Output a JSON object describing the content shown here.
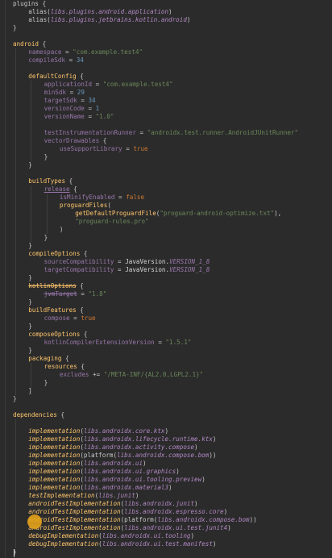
{
  "editor": {
    "lines": [
      {
        "indent": 0,
        "tokens": [
          [
            "plugins {",
            "t-plain"
          ]
        ]
      },
      {
        "indent": 1,
        "tokens": [
          [
            "alias(",
            "t-plain"
          ],
          [
            "libs.plugins.android.application",
            "t-lib"
          ],
          [
            ")",
            "t-plain"
          ]
        ]
      },
      {
        "indent": 1,
        "tokens": [
          [
            "alias(",
            "t-plain"
          ],
          [
            "libs.plugins.jetbrains.kotlin.android",
            "t-lib"
          ],
          [
            ")",
            "t-plain"
          ]
        ]
      },
      {
        "indent": 0,
        "tokens": [
          [
            "}",
            "t-plain"
          ]
        ]
      },
      {
        "indent": 0,
        "tokens": []
      },
      {
        "indent": 0,
        "tokens": [
          [
            "android",
            "t-fn"
          ],
          [
            " {",
            "t-plain"
          ]
        ]
      },
      {
        "indent": 1,
        "tokens": [
          [
            "namespace",
            "t-prop"
          ],
          [
            " = ",
            "t-plain"
          ],
          [
            "\"com.example.test4\"",
            "t-str"
          ]
        ]
      },
      {
        "indent": 1,
        "tokens": [
          [
            "compileSdk",
            "t-prop"
          ],
          [
            " = ",
            "t-plain"
          ],
          [
            "34",
            "t-num"
          ]
        ]
      },
      {
        "indent": 0,
        "tokens": []
      },
      {
        "indent": 1,
        "tokens": [
          [
            "defaultConfig",
            "t-fn"
          ],
          [
            " {",
            "t-plain"
          ]
        ]
      },
      {
        "indent": 2,
        "tokens": [
          [
            "applicationId",
            "t-prop"
          ],
          [
            " = ",
            "t-plain"
          ],
          [
            "\"com.example.test4\"",
            "t-str"
          ]
        ]
      },
      {
        "indent": 2,
        "tokens": [
          [
            "minSdk",
            "t-prop"
          ],
          [
            " = ",
            "t-plain"
          ],
          [
            "29",
            "t-num"
          ]
        ]
      },
      {
        "indent": 2,
        "tokens": [
          [
            "targetSdk",
            "t-prop"
          ],
          [
            " = ",
            "t-plain"
          ],
          [
            "34",
            "t-num"
          ]
        ]
      },
      {
        "indent": 2,
        "tokens": [
          [
            "versionCode",
            "t-prop"
          ],
          [
            " = ",
            "t-plain"
          ],
          [
            "1",
            "t-num"
          ]
        ]
      },
      {
        "indent": 2,
        "tokens": [
          [
            "versionName",
            "t-prop"
          ],
          [
            " = ",
            "t-plain"
          ],
          [
            "\"1.0\"",
            "t-str"
          ]
        ]
      },
      {
        "indent": 0,
        "tokens": []
      },
      {
        "indent": 2,
        "tokens": [
          [
            "testInstrumentationRunner",
            "t-prop"
          ],
          [
            " = ",
            "t-plain"
          ],
          [
            "\"androidx.test.runner.AndroidJUnitRunner\"",
            "t-str"
          ]
        ]
      },
      {
        "indent": 2,
        "tokens": [
          [
            "vectorDrawables",
            "t-prop"
          ],
          [
            " {",
            "t-plain"
          ]
        ]
      },
      {
        "indent": 3,
        "tokens": [
          [
            "useSupportLibrary",
            "t-prop"
          ],
          [
            " = ",
            "t-plain"
          ],
          [
            "true",
            "t-kw"
          ]
        ]
      },
      {
        "indent": 2,
        "tokens": [
          [
            "}",
            "t-plain"
          ]
        ]
      },
      {
        "indent": 1,
        "tokens": [
          [
            "}",
            "t-plain"
          ]
        ]
      },
      {
        "indent": 0,
        "tokens": []
      },
      {
        "indent": 1,
        "tokens": [
          [
            "buildTypes",
            "t-fn"
          ],
          [
            " {",
            "t-plain"
          ]
        ]
      },
      {
        "indent": 2,
        "tokens": [
          [
            "release",
            "t-prop t-under"
          ],
          [
            " {",
            "t-plain"
          ]
        ]
      },
      {
        "indent": 3,
        "tokens": [
          [
            "isMinifyEnabled",
            "t-prop"
          ],
          [
            " = ",
            "t-plain"
          ],
          [
            "false",
            "t-kw"
          ]
        ]
      },
      {
        "indent": 3,
        "tokens": [
          [
            "proguardFiles",
            "t-fn"
          ],
          [
            "(",
            "t-plain"
          ]
        ]
      },
      {
        "indent": 4,
        "tokens": [
          [
            "getDefaultProguardFile",
            "t-fn"
          ],
          [
            "(",
            "t-plain"
          ],
          [
            "\"proguard-android-optimize.txt\"",
            "t-str"
          ],
          [
            "),",
            "t-plain"
          ]
        ]
      },
      {
        "indent": 4,
        "tokens": [
          [
            "\"proguard-rules.pro\"",
            "t-str"
          ]
        ]
      },
      {
        "indent": 3,
        "tokens": [
          [
            ")",
            "t-plain"
          ]
        ]
      },
      {
        "indent": 2,
        "tokens": [
          [
            "}",
            "t-plain"
          ]
        ]
      },
      {
        "indent": 1,
        "tokens": [
          [
            "}",
            "t-plain"
          ]
        ]
      },
      {
        "indent": 1,
        "tokens": [
          [
            "compileOptions",
            "t-fn"
          ],
          [
            " {",
            "t-plain"
          ]
        ]
      },
      {
        "indent": 2,
        "tokens": [
          [
            "sourceCompatibility",
            "t-prop"
          ],
          [
            " = ",
            "t-plain"
          ],
          [
            "JavaVersion.",
            "t-ident"
          ],
          [
            "VERSION_1_8",
            "t-const"
          ]
        ]
      },
      {
        "indent": 2,
        "tokens": [
          [
            "targetCompatibility",
            "t-prop"
          ],
          [
            " = ",
            "t-plain"
          ],
          [
            "JavaVersion.",
            "t-ident"
          ],
          [
            "VERSION_1_8",
            "t-const"
          ]
        ]
      },
      {
        "indent": 1,
        "tokens": [
          [
            "}",
            "t-plain"
          ]
        ]
      },
      {
        "indent": 1,
        "tokens": [
          [
            "kotlinOptions",
            "t-fn t-strike"
          ],
          [
            " {",
            "t-plain"
          ]
        ]
      },
      {
        "indent": 2,
        "tokens": [
          [
            "jvmTarget",
            "t-prop t-strike"
          ],
          [
            " = ",
            "t-plain"
          ],
          [
            "\"1.8\"",
            "t-str"
          ]
        ]
      },
      {
        "indent": 1,
        "tokens": [
          [
            "}",
            "t-plain"
          ]
        ]
      },
      {
        "indent": 1,
        "tokens": [
          [
            "buildFeatures",
            "t-fn"
          ],
          [
            " {",
            "t-plain"
          ]
        ]
      },
      {
        "indent": 2,
        "tokens": [
          [
            "compose",
            "t-prop"
          ],
          [
            " = ",
            "t-plain"
          ],
          [
            "true",
            "t-kw"
          ]
        ]
      },
      {
        "indent": 1,
        "tokens": [
          [
            "}",
            "t-plain"
          ]
        ]
      },
      {
        "indent": 1,
        "tokens": [
          [
            "composeOptions",
            "t-fn"
          ],
          [
            " {",
            "t-plain"
          ]
        ]
      },
      {
        "indent": 2,
        "tokens": [
          [
            "kotlinCompilerExtensionVersion",
            "t-prop"
          ],
          [
            " = ",
            "t-plain"
          ],
          [
            "\"1.5.1\"",
            "t-str"
          ]
        ]
      },
      {
        "indent": 1,
        "tokens": [
          [
            "}",
            "t-plain"
          ]
        ]
      },
      {
        "indent": 1,
        "tokens": [
          [
            "packaging",
            "t-fn"
          ],
          [
            " {",
            "t-plain"
          ]
        ]
      },
      {
        "indent": 2,
        "tokens": [
          [
            "resources",
            "t-fn"
          ],
          [
            " {",
            "t-plain"
          ]
        ]
      },
      {
        "indent": 3,
        "tokens": [
          [
            "excludes",
            "t-prop"
          ],
          [
            " += ",
            "t-plain"
          ],
          [
            "\"/META-INF/{AL2.0,LGPL2.1}\"",
            "t-str"
          ]
        ]
      },
      {
        "indent": 2,
        "tokens": [
          [
            "}",
            "t-plain"
          ]
        ]
      },
      {
        "indent": 1,
        "tokens": [
          [
            "}",
            "t-plain"
          ]
        ]
      },
      {
        "indent": 0,
        "tokens": [
          [
            "}",
            "t-plain"
          ]
        ]
      },
      {
        "indent": 0,
        "tokens": []
      },
      {
        "indent": 0,
        "tokens": [
          [
            "dependencies",
            "t-fn"
          ],
          [
            " {",
            "t-plain"
          ]
        ]
      },
      {
        "indent": 0,
        "tokens": []
      },
      {
        "indent": 1,
        "tokens": [
          [
            "implementation",
            "t-ital-fn"
          ],
          [
            "(",
            "t-plain"
          ],
          [
            "libs.androidx.core.ktx",
            "t-lib"
          ],
          [
            ")",
            "t-plain"
          ]
        ]
      },
      {
        "indent": 1,
        "tokens": [
          [
            "implementation",
            "t-ital-fn"
          ],
          [
            "(",
            "t-plain"
          ],
          [
            "libs.androidx.lifecycle.runtime.ktx",
            "t-lib"
          ],
          [
            ")",
            "t-plain"
          ]
        ]
      },
      {
        "indent": 1,
        "tokens": [
          [
            "implementation",
            "t-ital-fn"
          ],
          [
            "(",
            "t-plain"
          ],
          [
            "libs.androidx.activity.compose",
            "t-lib"
          ],
          [
            ")",
            "t-plain"
          ]
        ]
      },
      {
        "indent": 1,
        "tokens": [
          [
            "implementation",
            "t-ital-fn"
          ],
          [
            "(platform(",
            "t-plain"
          ],
          [
            "libs.androidx.compose.bom",
            "t-lib"
          ],
          [
            "))",
            "t-plain"
          ]
        ]
      },
      {
        "indent": 1,
        "tokens": [
          [
            "implementation",
            "t-ital-fn"
          ],
          [
            "(",
            "t-plain"
          ],
          [
            "libs.androidx.ui",
            "t-lib"
          ],
          [
            ")",
            "t-plain"
          ]
        ]
      },
      {
        "indent": 1,
        "tokens": [
          [
            "implementation",
            "t-ital-fn"
          ],
          [
            "(",
            "t-plain"
          ],
          [
            "libs.androidx.ui.graphics",
            "t-lib"
          ],
          [
            ")",
            "t-plain"
          ]
        ]
      },
      {
        "indent": 1,
        "tokens": [
          [
            "implementation",
            "t-ital-fn"
          ],
          [
            "(",
            "t-plain"
          ],
          [
            "libs.androidx.ui.tooling.preview",
            "t-lib"
          ],
          [
            ")",
            "t-plain"
          ]
        ]
      },
      {
        "indent": 1,
        "tokens": [
          [
            "implementation",
            "t-ital-fn"
          ],
          [
            "(",
            "t-plain"
          ],
          [
            "libs.androidx.material3",
            "t-lib"
          ],
          [
            ")",
            "t-plain"
          ]
        ]
      },
      {
        "indent": 1,
        "tokens": [
          [
            "testImplementation",
            "t-ital-fn"
          ],
          [
            "(",
            "t-plain"
          ],
          [
            "libs.junit",
            "t-lib"
          ],
          [
            ")",
            "t-plain"
          ]
        ]
      },
      {
        "indent": 1,
        "tokens": [
          [
            "androidTestImplementation",
            "t-ital-fn"
          ],
          [
            "(",
            "t-plain"
          ],
          [
            "libs.androidx.junit",
            "t-lib"
          ],
          [
            ")",
            "t-plain"
          ]
        ]
      },
      {
        "indent": 1,
        "tokens": [
          [
            "androidTestImplementation",
            "t-ital-fn"
          ],
          [
            "(",
            "t-plain"
          ],
          [
            "libs.androidx.espresso.core",
            "t-lib"
          ],
          [
            ")",
            "t-plain"
          ]
        ]
      },
      {
        "indent": 1,
        "tokens": [
          [
            "androidTestImplementation",
            "t-ital-fn"
          ],
          [
            "(platform(",
            "t-plain"
          ],
          [
            "libs.androidx.compose.bom",
            "t-lib"
          ],
          [
            "))",
            "t-plain"
          ]
        ]
      },
      {
        "indent": 1,
        "tokens": [
          [
            "androidTestImplementation",
            "t-ital-fn"
          ],
          [
            "(",
            "t-plain"
          ],
          [
            "libs.androidx.ui.test.junit4",
            "t-lib"
          ],
          [
            ")",
            "t-plain"
          ]
        ]
      },
      {
        "indent": 1,
        "tokens": [
          [
            "debugImplementation",
            "t-ital-fn"
          ],
          [
            "(",
            "t-plain"
          ],
          [
            "libs.androidx.ui.tooling",
            "t-lib"
          ],
          [
            ")",
            "t-plain"
          ]
        ]
      },
      {
        "indent": 1,
        "tokens": [
          [
            "debugImplementation",
            "t-ital-fn"
          ],
          [
            "(",
            "t-plain"
          ],
          [
            "libs.androidx.ui.test.manifest",
            "t-lib"
          ],
          [
            ")",
            "t-plain"
          ]
        ]
      },
      {
        "indent": 0,
        "tokens": [
          [
            "}",
            "t-plain"
          ]
        ]
      }
    ]
  },
  "colors": {
    "background": "#2b2b2b",
    "keyword": "#cc7832",
    "function": "#ffc66d",
    "string": "#6a8759",
    "number": "#6897bb",
    "property": "#9876aa"
  }
}
